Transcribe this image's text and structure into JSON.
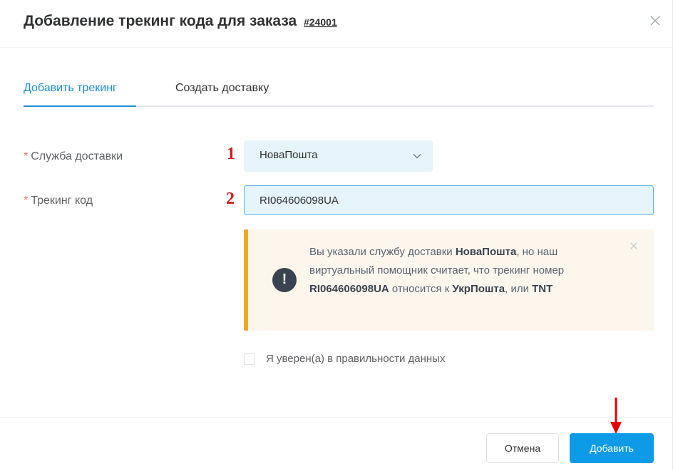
{
  "header": {
    "title": "Добавление трекинг кода для заказа",
    "order_number": "#24001"
  },
  "tabs": [
    {
      "label": "Добавить трекинг",
      "active": true
    },
    {
      "label": "Создать доставку",
      "active": false
    }
  ],
  "form": {
    "required_mark": "*",
    "delivery_service": {
      "label": "Служба доставки",
      "marker": "1",
      "value": "НоваПошта"
    },
    "tracking_code": {
      "label": "Трекинг код",
      "marker": "2",
      "value": "RI064606098UA"
    }
  },
  "alert": {
    "text_1": "Вы указали службу доставки ",
    "service": "НоваПошта",
    "text_2": ", но наш виртуальный помощник считает, что трекинг номер ",
    "code": "RI064606098UA",
    "text_3": " относится к ",
    "suggested_1": "УкрПошта",
    "text_4": ", или ",
    "suggested_2": "TNT",
    "icon_symbol": "!"
  },
  "confirm": {
    "label": "Я уверен(а) в правильности данных",
    "checked": false
  },
  "footer": {
    "cancel_label": "Отмена",
    "add_label": "Добавить"
  },
  "colors": {
    "accent": "#0d9be8",
    "required": "#f56c6c",
    "alert_border": "#f5a623",
    "alert_bg": "#fdf6ec",
    "marker_red": "#d7191c"
  },
  "icons": [
    "close-icon",
    "chevron-down-icon",
    "exclamation-icon",
    "alert-close-icon",
    "arrow-down-icon"
  ]
}
